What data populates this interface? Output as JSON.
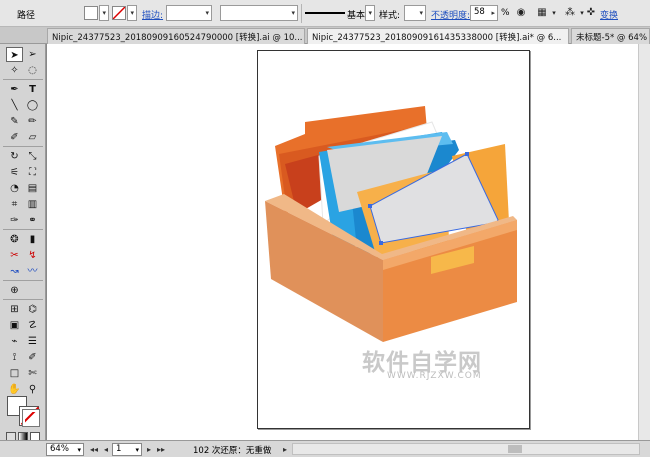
{
  "control_bar": {
    "label": "路径",
    "stroke_label": "描边:",
    "brush_label": "基本",
    "style_label": "样式:",
    "opacity_label": "不透明度:",
    "opacity_value": "58",
    "percent": "%",
    "transform_label": "变换"
  },
  "tabs": [
    {
      "label": "Nipic_24377523_20180909160524790000 [转换].ai @ 10..."
    },
    {
      "label": "Nipic_24377523_20180909161435338000 [转换].ai* @ 6..."
    },
    {
      "label": "未标题-5* @ 64%"
    }
  ],
  "watermark": {
    "text": "软件自学网",
    "url": "WWW.RJZXW.COM"
  },
  "status_bar": {
    "zoom": "64%",
    "page": "1",
    "info": "102 次还原：无重做"
  },
  "colors": {
    "folder_orange": "#e8702a",
    "folder_blue": "#2a9ee0",
    "folder_yellow": "#f5a53a",
    "box_front": "#eb8a45",
    "box_side": "#d9793a",
    "selection": "#3a6ae0"
  },
  "icons": [
    "stroke-swatch-icon",
    "selection-tool-icon",
    "direct-selection-icon",
    "magic-wand-icon",
    "lasso-icon",
    "pen-icon",
    "type-icon",
    "line-icon",
    "ellipse-icon",
    "brush-icon",
    "pencil-icon",
    "blob-brush-icon",
    "eraser-icon",
    "rotate-icon",
    "scale-icon",
    "width-icon",
    "free-transform-icon",
    "shape-builder-icon",
    "perspective-icon",
    "mesh-icon",
    "gradient-icon",
    "eyedropper-icon",
    "blend-icon",
    "symbol-sprayer-icon",
    "column-graph-icon",
    "artboard-icon",
    "slice-icon",
    "hand-icon",
    "zoom-icon"
  ]
}
